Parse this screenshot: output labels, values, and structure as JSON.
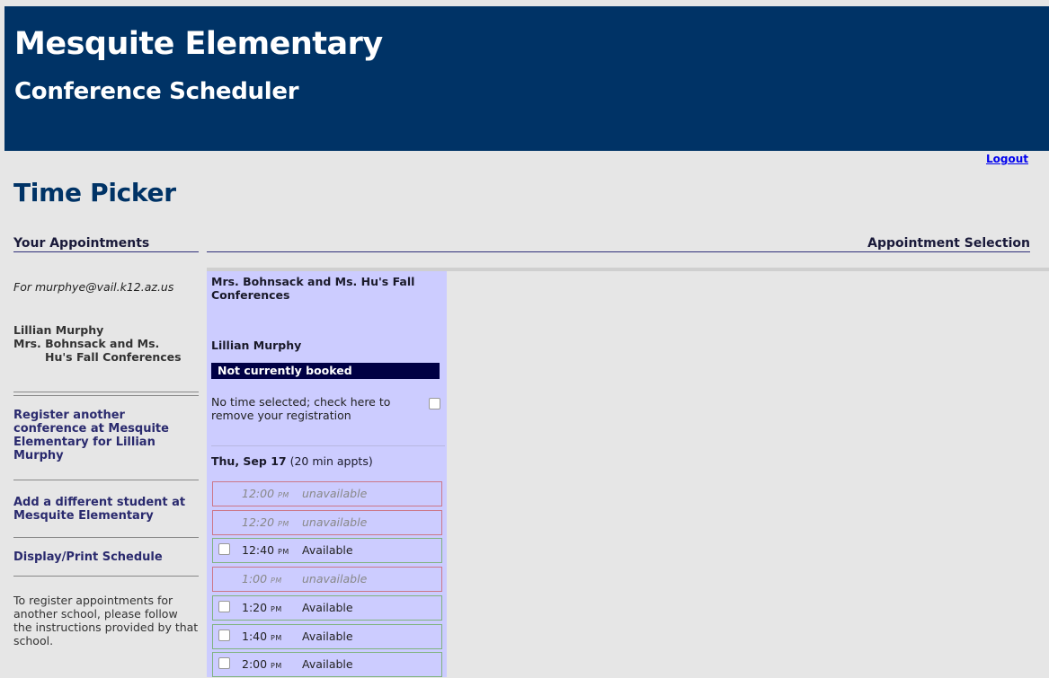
{
  "header": {
    "school": "Mesquite Elementary",
    "app": "Conference Scheduler"
  },
  "logout_label": "Logout",
  "page_title": "Time Picker",
  "sections": {
    "left": "Your Appointments",
    "right": "Appointment Selection"
  },
  "sidebar": {
    "for_line": "For murphye@vail.k12.az.us",
    "student_name": "Lillian Murphy",
    "conference_line1": "Mrs. Bohnsack and Ms.",
    "conference_line2": "Hu's Fall Conferences",
    "nav": {
      "register_another": "Register another conference at Mesquite Elementary for Lillian Murphy",
      "add_student": "Add a different student at Mesquite Elementary",
      "display_print": "Display/Print Schedule"
    },
    "help_text": "To register appointments for another school, please follow the instructions provided by that school."
  },
  "panel": {
    "title": "Mrs. Bohnsack and Ms. Hu's Fall Conferences",
    "student": "Lillian Murphy",
    "status": "Not currently booked",
    "remove_text": "No time selected; check here to remove your registration",
    "day": {
      "date": "Thu, Sep 17",
      "note": "(20 min appts)"
    },
    "slots": [
      {
        "time": "12:00",
        "ampm": "PM",
        "status": "unavailable"
      },
      {
        "time": "12:20",
        "ampm": "PM",
        "status": "unavailable"
      },
      {
        "time": "12:40",
        "ampm": "PM",
        "status": "Available"
      },
      {
        "time": "1:00",
        "ampm": "PM",
        "status": "unavailable"
      },
      {
        "time": "1:20",
        "ampm": "PM",
        "status": "Available"
      },
      {
        "time": "1:40",
        "ampm": "PM",
        "status": "Available"
      },
      {
        "time": "2:00",
        "ampm": "PM",
        "status": "Available"
      }
    ]
  }
}
